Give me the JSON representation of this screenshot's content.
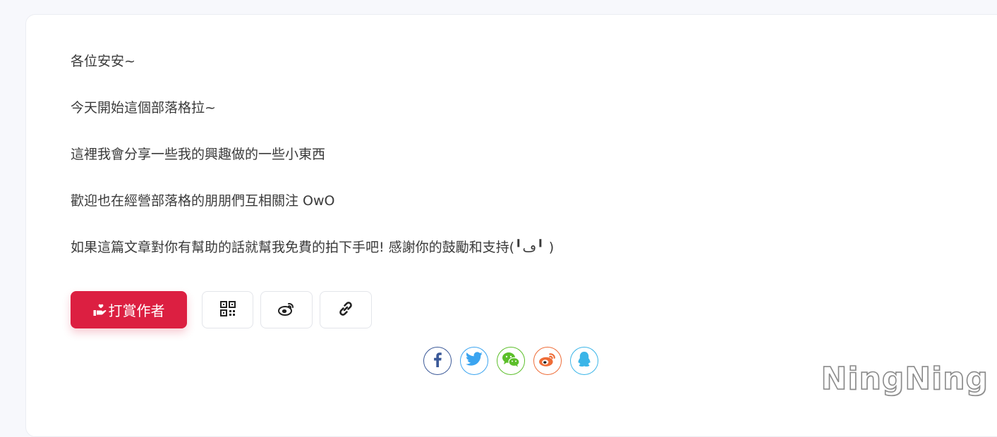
{
  "post": {
    "paragraphs": [
      "各位安安~",
      "今天開始這個部落格拉~",
      "這裡我會分享一些我的興趣做的一些小東西",
      "歡迎也在經營部落格的朋朋們互相關注 OwO",
      "如果這篇文章對你有幫助的話就幫我免費的拍下手吧! 感謝你的鼓勵和支持(╹ڡ╹ )"
    ]
  },
  "actions": {
    "reward_label": "打賞作者",
    "reward_icon": "hand-holding-heart-icon",
    "qr_icon": "qrcode-icon",
    "weibo_icon": "weibo-icon",
    "link_icon": "link-icon",
    "accent_color": "#dc1f41"
  },
  "share": [
    {
      "icon": "facebook-icon",
      "color": "#3b5998"
    },
    {
      "icon": "twitter-icon",
      "color": "#3aa4f0"
    },
    {
      "icon": "wechat-icon",
      "color": "#5cbf2a"
    },
    {
      "icon": "weibo-icon",
      "color": "#ee6c37"
    },
    {
      "icon": "qq-icon",
      "color": "#3ab5e8"
    }
  ],
  "watermark": "NingNing"
}
